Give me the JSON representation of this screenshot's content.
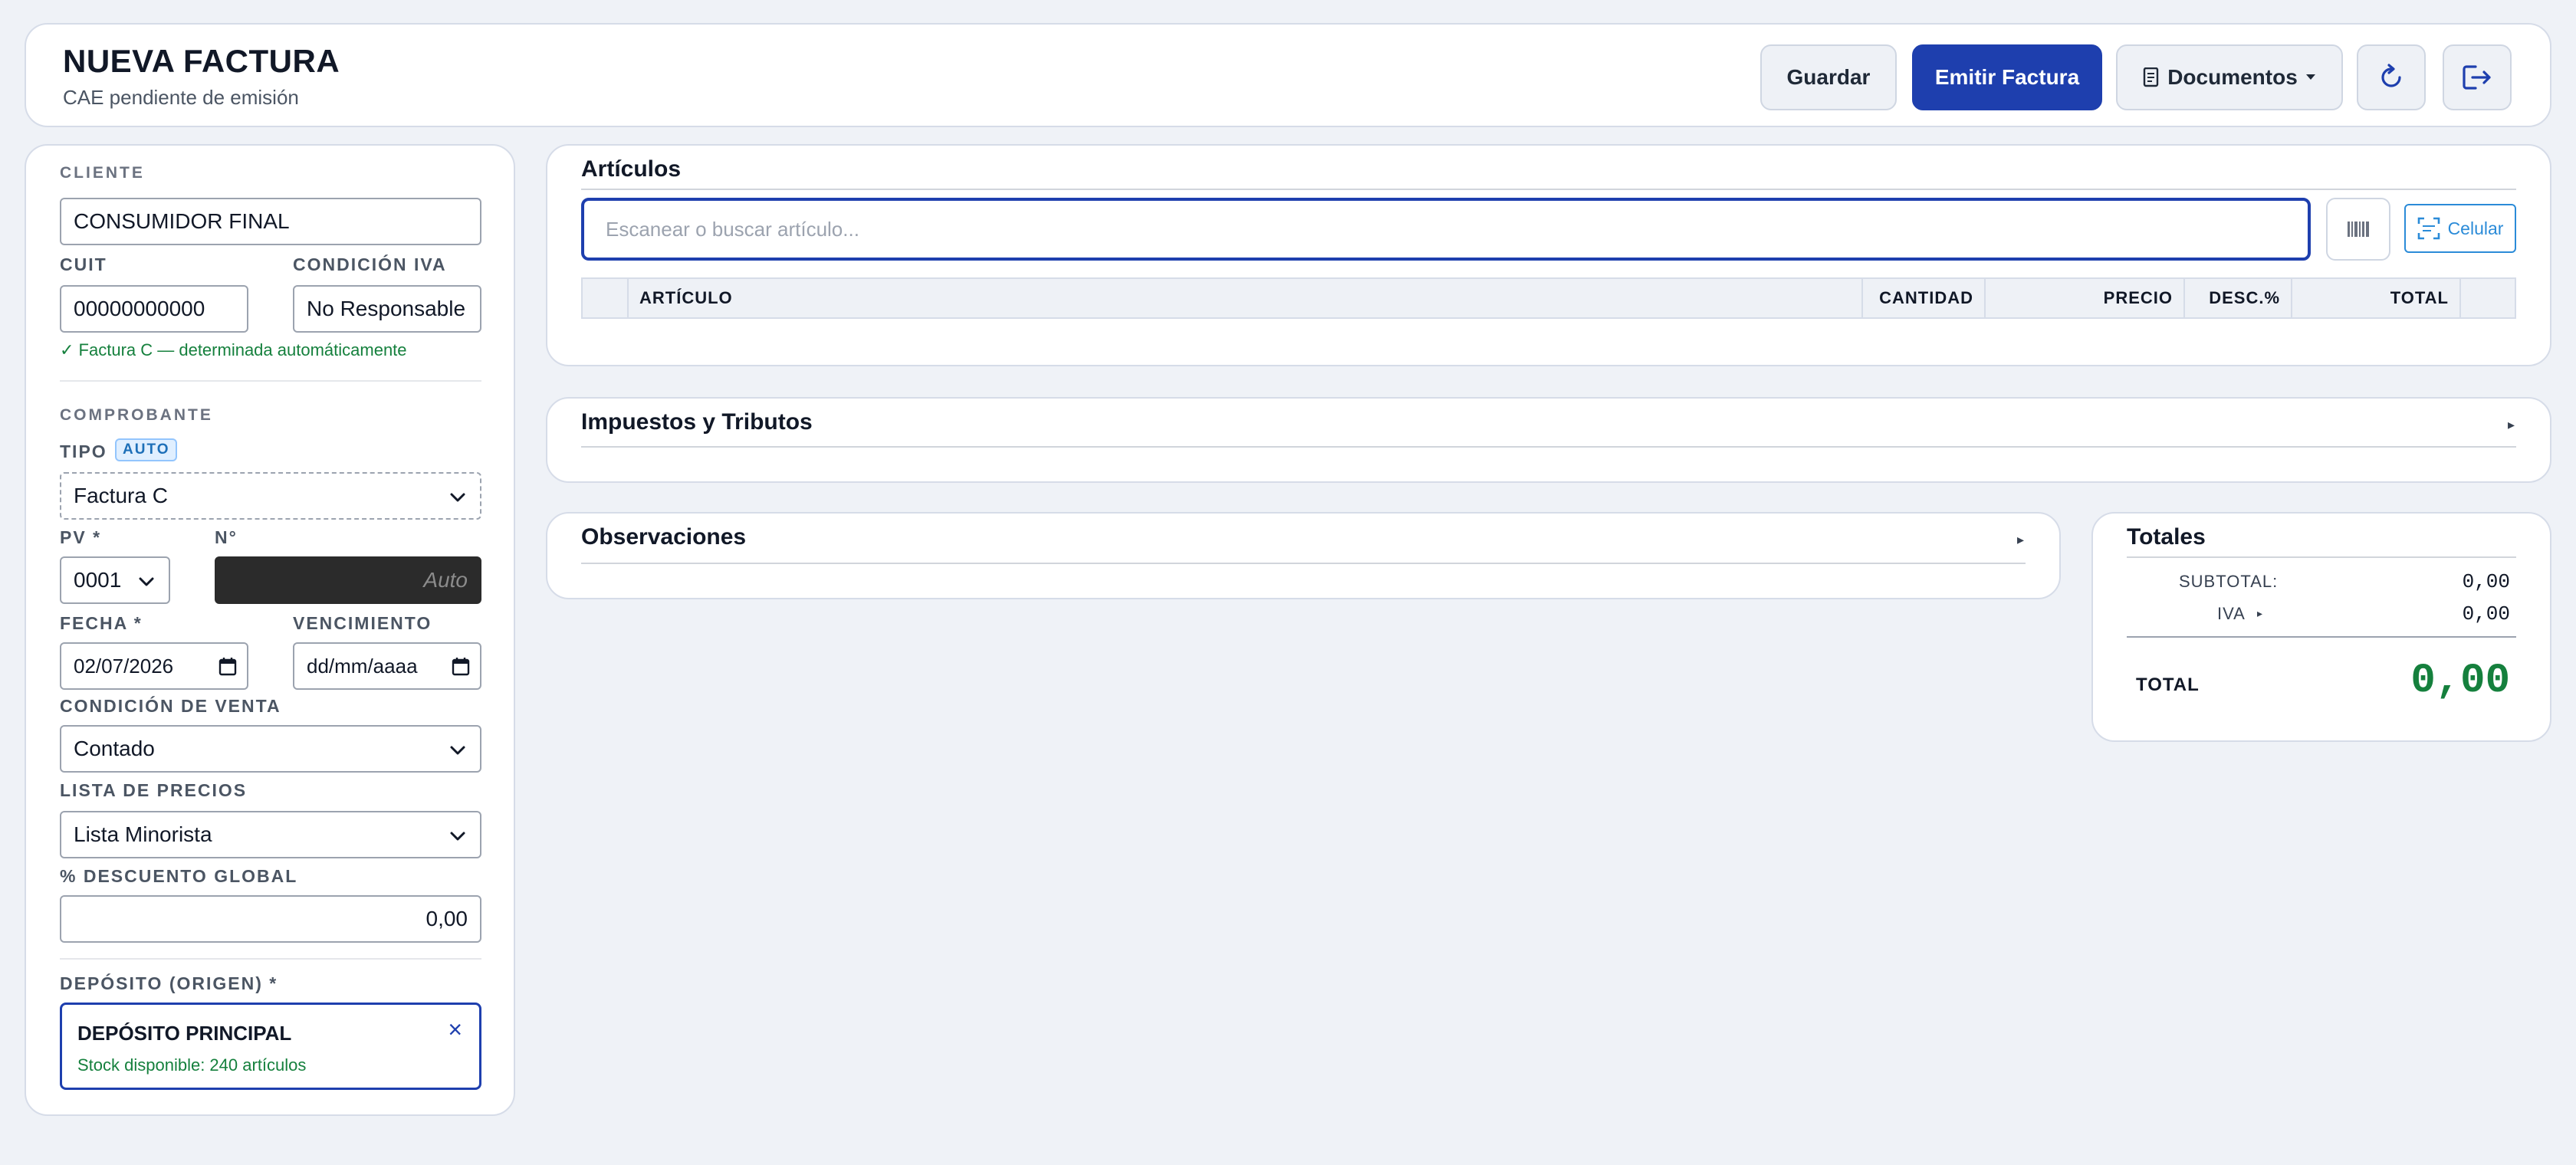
{
  "header": {
    "title": "NUEVA FACTURA",
    "subtitle": "CAE pendiente de emisión",
    "save_label": "Guardar",
    "emit_label": "Emitir Factura",
    "documents_label": "Documentos",
    "refresh_icon": "refresh-icon",
    "logout_icon": "logout-icon"
  },
  "client": {
    "section": "CLIENTE",
    "name": "CONSUMIDOR FINAL",
    "cuit_label": "CUIT",
    "cuit": "00000000000",
    "iva_label": "CONDICIÓN IVA",
    "iva": "No Responsable",
    "auto_msg": "✓ Factura C — determinada automáticamente"
  },
  "voucher": {
    "section": "COMPROBANTE",
    "tipo_label": "TIPO",
    "auto_badge": "AUTO",
    "tipo": "Factura C",
    "pv_label": "PV *",
    "pv": "0001",
    "numero_label": "N°",
    "numero_placeholder": "Auto",
    "fecha_label": "FECHA *",
    "fecha": "02/07/2026",
    "venc_label": "VENCIMIENTO",
    "venc_placeholder": "dd/mm/aaaa",
    "venta_label": "CONDICIÓN DE VENTA",
    "venta": "Contado",
    "lista_label": "LISTA DE PRECIOS",
    "lista": "Lista Minorista",
    "desc_label": "% DESCUENTO GLOBAL",
    "desc": "0,00"
  },
  "deposit": {
    "label": "DEPÓSITO (ORIGEN) *",
    "name": "DEPÓSITO PRINCIPAL",
    "stock": "Stock disponible: 240 artículos",
    "remove": "×"
  },
  "articles": {
    "title": "Artículos",
    "search_placeholder": "Escanear o buscar artículo...",
    "barcode_icon": "barcode-icon",
    "celular_label": "Celular",
    "columns": [
      "ARTÍCULO",
      "CANTIDAD",
      "PRECIO",
      "DESC.%",
      "TOTAL"
    ]
  },
  "taxes": {
    "title": "Impuestos y Tributos"
  },
  "notes": {
    "title": "Observaciones"
  },
  "totals": {
    "title": "Totales",
    "subtotal_label": "SUBTOTAL:",
    "subtotal": "0,00",
    "iva_label": "IVA",
    "iva": "0,00",
    "total_label": "TOTAL",
    "total": "0,00"
  },
  "colors": {
    "primary": "#1e3fae",
    "success": "#15803d",
    "background": "#eff2f7",
    "accent_blue": "#2b8bd8"
  }
}
